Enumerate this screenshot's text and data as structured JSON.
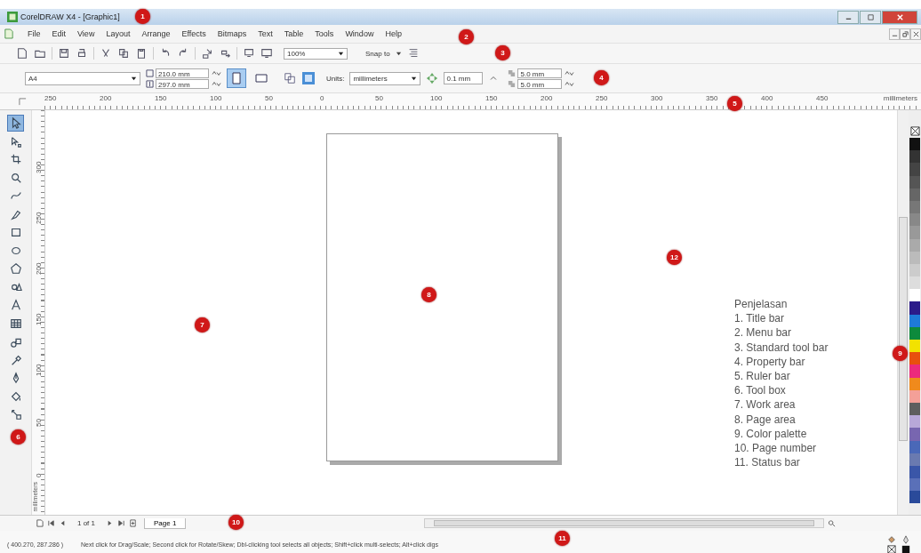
{
  "title_bar": {
    "title": "CorelDRAW X4 - [Graphic1]"
  },
  "menu_bar": {
    "items": [
      "File",
      "Edit",
      "View",
      "Layout",
      "Arrange",
      "Effects",
      "Bitmaps",
      "Text",
      "Table",
      "Tools",
      "Window",
      "Help"
    ]
  },
  "standard_toolbar": {
    "zoom": "100%",
    "snap": "Snap to"
  },
  "property_bar": {
    "paper": "A4",
    "width": "210.0 mm",
    "height": "297.0 mm",
    "orientation": [
      {
        "kind": "portrait",
        "selected": true
      },
      {
        "kind": "landscape",
        "selected": false
      }
    ],
    "units_label": "Units:",
    "units": "millimeters",
    "nudge": "0.1 mm",
    "duplicate_x": "5.0 mm",
    "duplicate_y": "5.0 mm"
  },
  "horizontal_ruler": {
    "labels": [
      "250",
      "200",
      "150",
      "100",
      "50",
      "0",
      "50",
      "100",
      "150",
      "200",
      "250",
      "300",
      "350",
      "400",
      "450"
    ],
    "unit": "millimeters"
  },
  "vertical_ruler": {
    "labels": [
      "300",
      "250",
      "200",
      "150",
      "100",
      "50",
      "0"
    ],
    "unit": "millimeters"
  },
  "toolbox": [
    {
      "kind": "pick",
      "selected": true
    },
    {
      "kind": "shape",
      "selected": false
    },
    {
      "kind": "crop",
      "selected": false
    },
    {
      "kind": "zoom",
      "selected": false
    },
    {
      "kind": "freehand",
      "selected": false
    },
    {
      "kind": "smart",
      "selected": false
    },
    {
      "kind": "rectangle",
      "selected": false
    },
    {
      "kind": "ellipse",
      "selected": false
    },
    {
      "kind": "polygon",
      "selected": false
    },
    {
      "kind": "shapes",
      "selected": false
    },
    {
      "kind": "text",
      "selected": false
    },
    {
      "kind": "table",
      "selected": false
    },
    {
      "kind": "blend",
      "selected": false
    },
    {
      "kind": "eyedropper",
      "selected": false
    },
    {
      "kind": "outline",
      "selected": false
    },
    {
      "kind": "fill",
      "selected": false
    },
    {
      "kind": "interactive",
      "selected": false
    }
  ],
  "explanation": {
    "heading": "Penjelasan",
    "items": [
      "1. Title bar",
      "2. Menu bar",
      "3. Standard tool bar",
      "4. Property bar",
      "5. Ruler bar",
      "6. Tool box",
      "7. Work area",
      "8. Page area",
      "9. Color palette",
      "10. Page number",
      "11. Status bar"
    ]
  },
  "palette": [
    {
      "color": "#111111"
    },
    {
      "color": "#333333"
    },
    {
      "color": "#444444"
    },
    {
      "color": "#555555"
    },
    {
      "color": "#666666"
    },
    {
      "color": "#777777"
    },
    {
      "color": "#888888"
    },
    {
      "color": "#999999"
    },
    {
      "color": "#aaaaaa"
    },
    {
      "color": "#bbbbbb"
    },
    {
      "color": "#cccccc"
    },
    {
      "color": "#dddddd"
    },
    {
      "color": "#ffffff"
    },
    {
      "color": "#2b1b8a"
    },
    {
      "color": "#1e7ad8"
    },
    {
      "color": "#0d8a3c"
    },
    {
      "color": "#f2e200"
    },
    {
      "color": "#e8500e"
    },
    {
      "color": "#ec2a7c"
    },
    {
      "color": "#f08a1c"
    },
    {
      "color": "#f4a098"
    },
    {
      "color": "#5e5e5e"
    },
    {
      "color": "#b8a8d8"
    },
    {
      "color": "#7866b0"
    },
    {
      "color": "#4a68b8"
    },
    {
      "color": "#6a7ab0"
    },
    {
      "color": "#3a56a8"
    },
    {
      "color": "#5a70b8"
    },
    {
      "color": "#2a4a9a"
    }
  ],
  "page_navigator": {
    "count": "1 of 1",
    "tab": "Page 1"
  },
  "status_bar": {
    "coordinates": "( 400.270, 287.286 )",
    "hint": "Next click for Drag/Scale; Second click for Rotate/Skew; Dbl-clicking tool selects all objects; Shift+click multi-selects; Alt+click digs"
  },
  "markers": [
    "1",
    "2",
    "3",
    "4",
    "5",
    "6",
    "7",
    "8",
    "9",
    "10",
    "11",
    "12"
  ]
}
